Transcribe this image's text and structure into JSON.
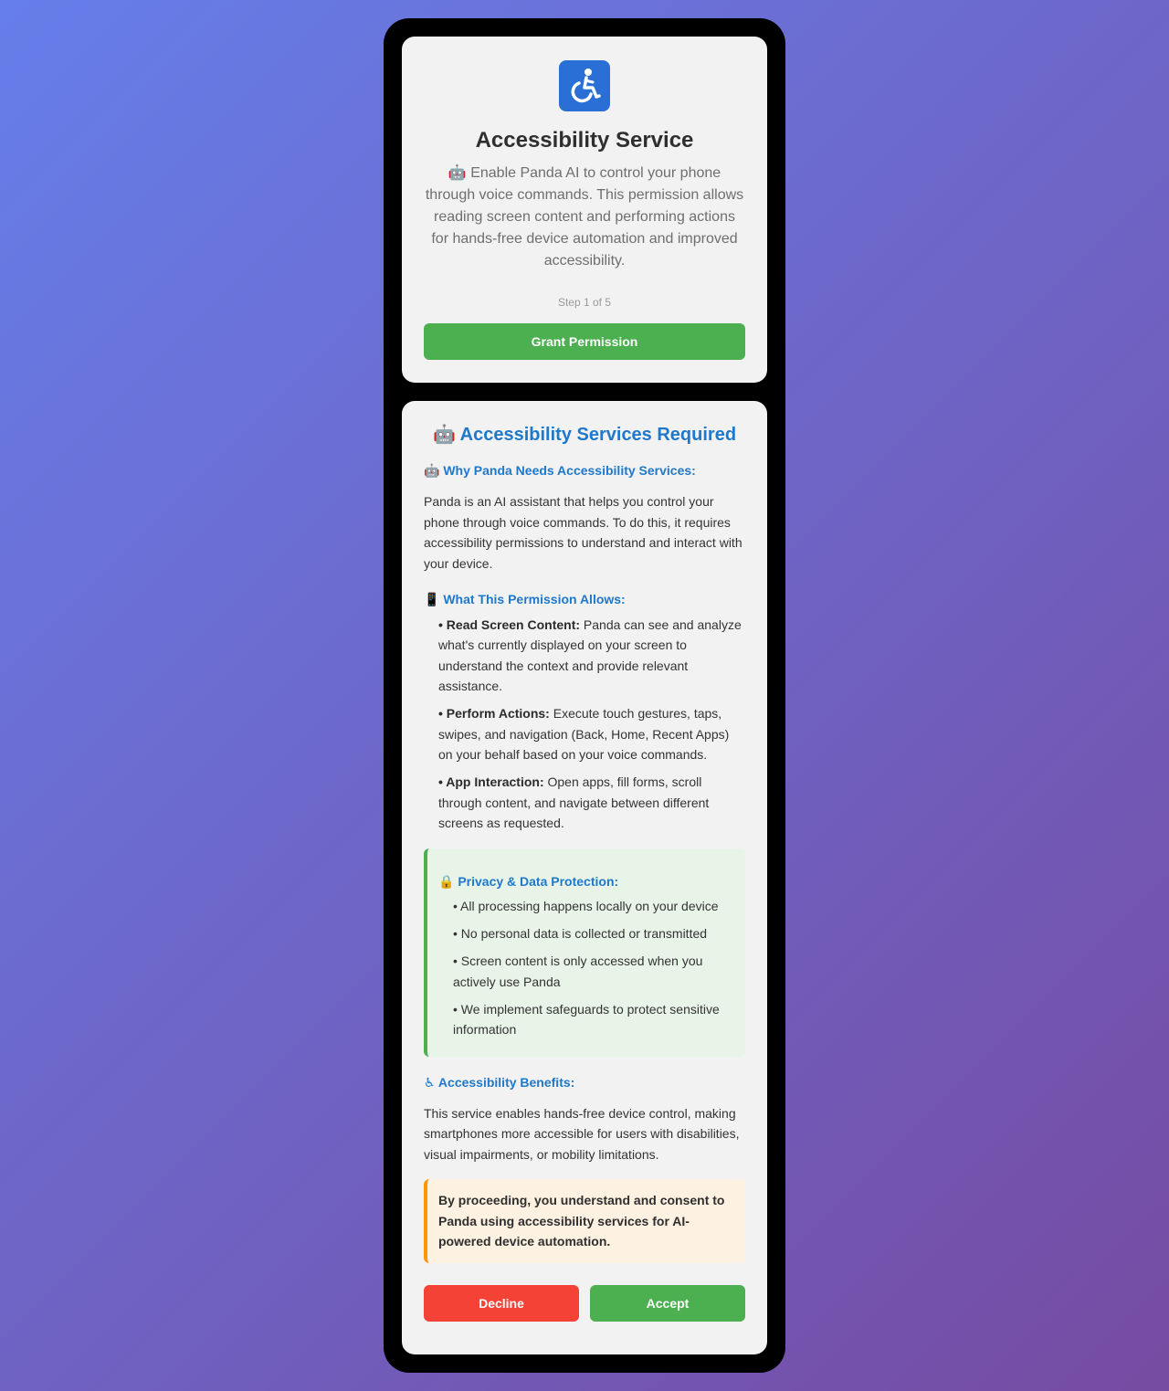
{
  "colors": {
    "accent_blue": "#1f78c9",
    "green": "#4caf50",
    "red": "#f44336",
    "orange": "#ff9800",
    "card_bg": "#f2f2f2"
  },
  "permission_card": {
    "icon": "wheelchair-icon",
    "title": "Accessibility Service",
    "description": "🤖 Enable Panda AI to control your phone through voice commands. This permission allows reading screen content and performing actions for hands-free device automation and improved accessibility.",
    "step": "Step 1 of 5",
    "grant_label": "Grant Permission"
  },
  "info_card": {
    "title": "🤖 Accessibility Services Required",
    "why_heading": "🤖 Why Panda Needs Accessibility Services:",
    "why_text": "Panda is an AI assistant that helps you control your phone through voice commands. To do this, it requires accessibility permissions to understand and interact with your device.",
    "allows_heading": "📱 What This Permission Allows:",
    "allows": [
      {
        "bold": "• Read Screen Content:",
        "text": " Panda can see and analyze what's currently displayed on your screen to understand the context and provide relevant assistance."
      },
      {
        "bold": "• Perform Actions:",
        "text": " Execute touch gestures, taps, swipes, and navigation (Back, Home, Recent Apps) on your behalf based on your voice commands."
      },
      {
        "bold": "• App Interaction:",
        "text": " Open apps, fill forms, scroll through content, and navigate between different screens as requested."
      }
    ],
    "privacy_heading": "🔒 Privacy & Data Protection:",
    "privacy_items": [
      "• All processing happens locally on your device",
      "• No personal data is collected or transmitted",
      "• Screen content is only accessed when you actively use Panda",
      "• We implement safeguards to protect sensitive information"
    ],
    "benefits_heading": "♿ Accessibility Benefits:",
    "benefits_text": "This service enables hands-free device control, making smartphones more accessible for users with disabilities, visual impairments, or mobility limitations.",
    "consent_text": "By proceeding, you understand and consent to Panda using accessibility services for AI-powered device automation.",
    "decline_label": "Decline",
    "accept_label": "Accept"
  }
}
